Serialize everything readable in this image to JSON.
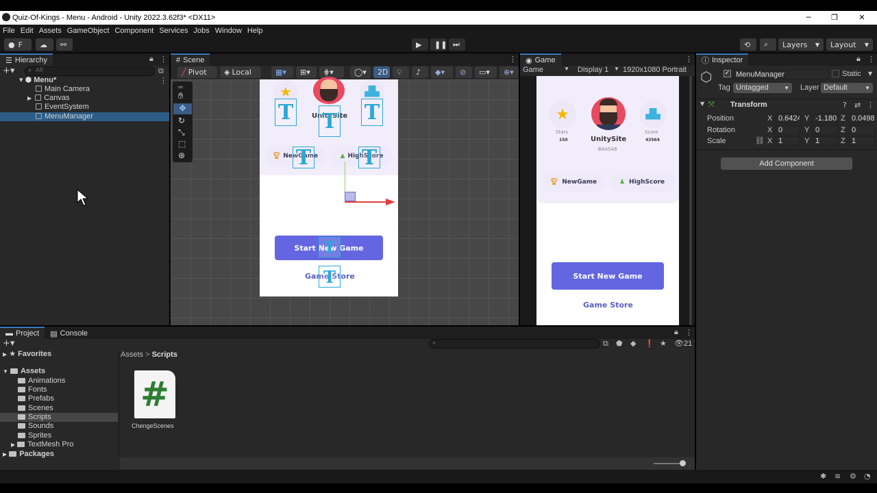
{
  "window": {
    "title": "Quiz-Of-Kings - Menu - Android - Unity 2022.3.62f3* <DX11>",
    "min": "─",
    "max": "❐",
    "close": "✕"
  },
  "menu": [
    "File",
    "Edit",
    "Assets",
    "GameObject",
    "Component",
    "Services",
    "Jobs",
    "Window",
    "Help"
  ],
  "toolbar": {
    "account": "F",
    "layers": "Layers",
    "layout": "Layout"
  },
  "hierarchy": {
    "tab": "Hierarchy",
    "search_placeholder": "All",
    "scene": "Menu*",
    "items": [
      "Main Camera",
      "Canvas",
      "EventSystem",
      "MenuManager"
    ]
  },
  "scene": {
    "tab": "Scene",
    "pivot": "Pivot",
    "local": "Local",
    "mode2d": "2D",
    "t_glyph": "T"
  },
  "game_ui": {
    "username": "UnitySite",
    "user_id": "B4A5A6",
    "stars_label": "Stars",
    "stars_value": "150",
    "score_label": "Score",
    "score_value": "43564",
    "new_game": "NewGame",
    "high_score": "HighScore",
    "start_button": "Start New Game",
    "store_link": "Game Store",
    "scene_username": "UnitySite",
    "scene_new_game": "NewGame",
    "scene_high_score": "HighScore"
  },
  "game": {
    "tab": "Game",
    "mode": "Game",
    "display": "Display 1",
    "resolution": "1920x1080 Portrait"
  },
  "inspector": {
    "tab": "Inspector",
    "name": "MenuManager",
    "static": "Static",
    "tag_label": "Tag",
    "tag": "Untagged",
    "layer_label": "Layer",
    "layer": "Default",
    "component": "Transform",
    "position_label": "Position",
    "rotation_label": "Rotation",
    "scale_label": "Scale",
    "pos": {
      "x": "0.6424",
      "y": "-1.180",
      "z": "0.0498"
    },
    "rot": {
      "x": "0",
      "y": "0",
      "z": "0"
    },
    "scl": {
      "x": "1",
      "y": "1",
      "z": "1"
    },
    "axis": {
      "x": "X",
      "y": "Y",
      "z": "Z"
    },
    "add_component": "Add Component"
  },
  "project": {
    "tab": "Project",
    "console_tab": "Console",
    "favorites": "Favorites",
    "assets": "Assets",
    "folders": [
      "Animations",
      "Fonts",
      "Prefabs",
      "Scenes",
      "Scripts",
      "Sounds",
      "Sprites",
      "TextMesh Pro"
    ],
    "packages": "Packages",
    "breadcrumb_root": "Assets",
    "breadcrumb_sep": ">",
    "breadcrumb_current": "Scripts",
    "file_name": "ChengeScenes",
    "file_glyph": "#",
    "count": "21"
  }
}
